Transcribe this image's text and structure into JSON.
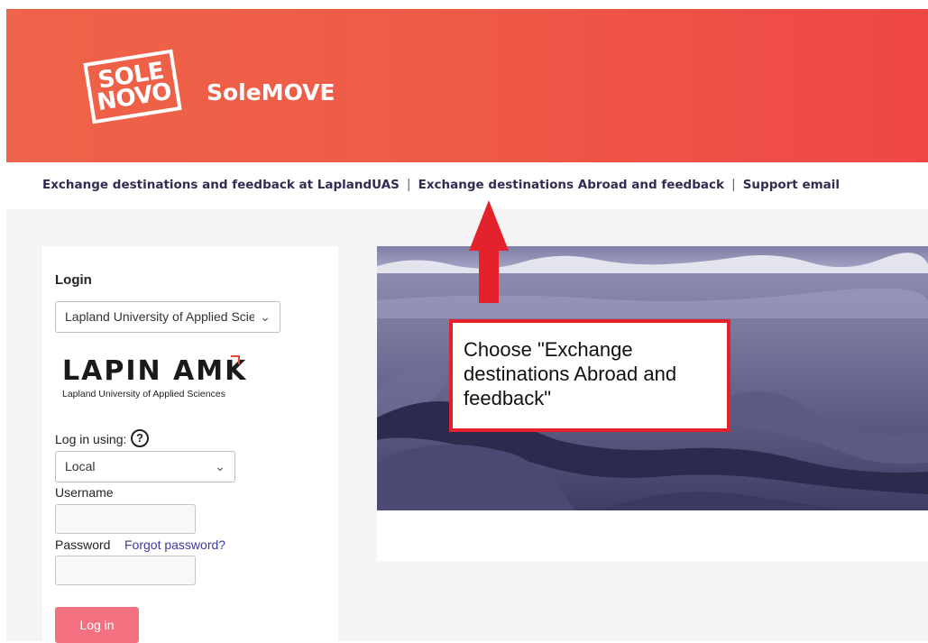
{
  "header": {
    "logo_line1": "SOLE",
    "logo_line2": "NOVO",
    "app_title": "SoleMOVE",
    "bg_color": "#ef5a47"
  },
  "nav": {
    "link1": "Exchange destinations and feedback at LaplandUAS",
    "link2": "Exchange destinations Abroad and feedback",
    "link3": "Support email",
    "separator": "|"
  },
  "login": {
    "title": "Login",
    "organization_value": "Lapland University of Applied Scie",
    "university_logo_name": "LAPIN AMK",
    "university_logo_sub": "Lapland University of Applied Sciences",
    "login_using_label": "Log in using:",
    "help_icon": "question-circle-icon",
    "method_value": "Local",
    "username_label": "Username",
    "username_value": "",
    "password_label": "Password",
    "password_value": "",
    "forgot_password": "Forgot password?",
    "login_button": "Log in",
    "button_color": "#f2707f"
  },
  "annotation": {
    "text": "Choose \"Exchange destinations Abroad and feedback\"",
    "border_color": "#e3222b",
    "arrow_icon": "arrow-up-icon"
  }
}
